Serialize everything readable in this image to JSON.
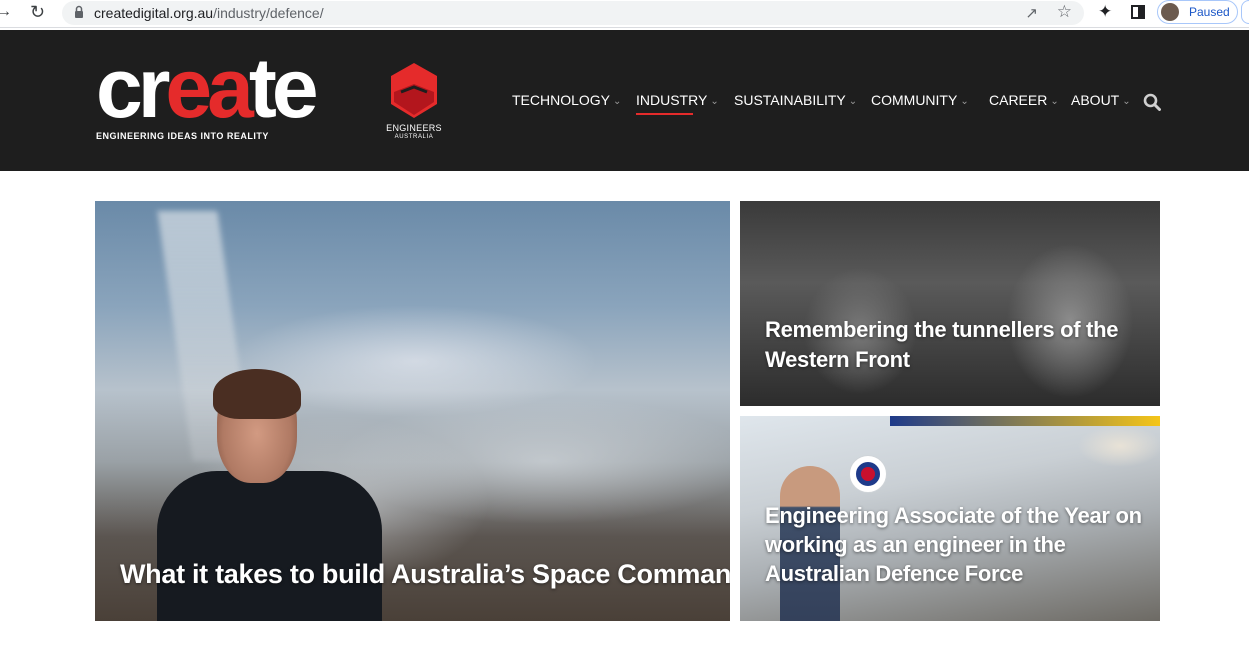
{
  "browser": {
    "url_host": "createdigital.org.au",
    "url_path": "/industry/defence/",
    "profile_status": "Paused"
  },
  "header": {
    "logo": {
      "word_white_1": "cr",
      "word_red": "ea",
      "word_white_2": "te",
      "tagline": "ENGINEERING IDEAS INTO REALITY"
    },
    "partner_logo": {
      "name": "ENGINEERS",
      "sub": "AUSTRALIA"
    },
    "nav": [
      {
        "label": "TECHNOLOGY",
        "active": false
      },
      {
        "label": "INDUSTRY",
        "active": true
      },
      {
        "label": "SUSTAINABILITY",
        "active": false
      },
      {
        "label": "COMMUNITY",
        "active": false
      },
      {
        "label": "CAREER",
        "active": false
      },
      {
        "label": "ABOUT",
        "active": false
      }
    ]
  },
  "articles": [
    {
      "title": "What it takes to build Australia’s Space Command"
    },
    {
      "title": "Remembering the tunnellers of the Western Front"
    },
    {
      "title": "Engineering Associate of the Year on working as an engineer in the Australian Defence Force"
    }
  ],
  "colors": {
    "accent": "#e52b2b",
    "header_bg": "#1e1e1e"
  }
}
